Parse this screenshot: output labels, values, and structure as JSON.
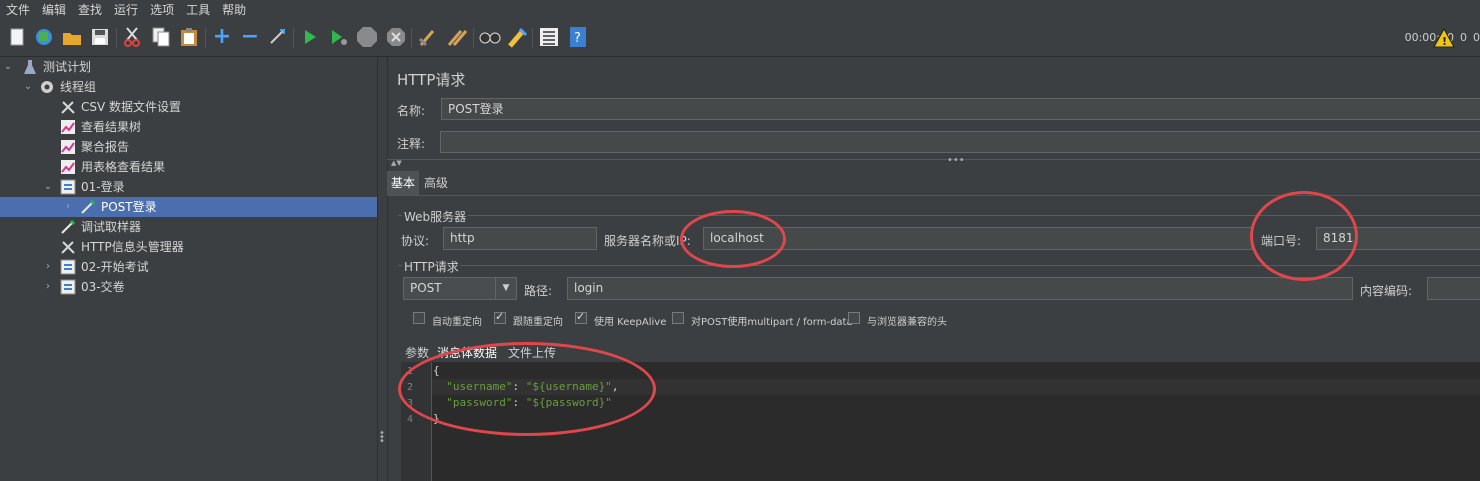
{
  "menu": [
    "文件",
    "编辑",
    "查找",
    "运行",
    "选项",
    "工具",
    "帮助"
  ],
  "toolbar": {
    "icons": [
      "new-icon",
      "templates-icon",
      "open-icon",
      "save-icon",
      "cut-icon",
      "copy-icon",
      "paste-icon",
      "expand-icon",
      "collapse-icon",
      "toggle-icon",
      "start-icon",
      "start-no-pause-icon",
      "stop-icon",
      "shutdown-icon",
      "clear-icon",
      "clear-all-icon",
      "search-icon",
      "reset-search-icon",
      "function-helper-icon",
      "help-icon"
    ],
    "timer": "00:00:00",
    "warn_count": "0",
    "thread_count": "0"
  },
  "tree": {
    "items": [
      {
        "label": "测试计划",
        "icon": "flask-icon"
      },
      {
        "label": "线程组",
        "icon": "gear-icon"
      },
      {
        "label": "CSV 数据文件设置",
        "icon": "wrench-icon"
      },
      {
        "label": "查看结果树",
        "icon": "chart-icon"
      },
      {
        "label": "聚合报告",
        "icon": "chart-icon"
      },
      {
        "label": "用表格查看结果",
        "icon": "chart-icon"
      },
      {
        "label": "01-登录",
        "icon": "controller-icon"
      },
      {
        "label": "POST登录",
        "icon": "sampler-icon"
      },
      {
        "label": "调试取样器",
        "icon": "sampler-icon"
      },
      {
        "label": "HTTP信息头管理器",
        "icon": "wrench-icon"
      },
      {
        "label": "02-开始考试",
        "icon": "controller-icon"
      },
      {
        "label": "03-交卷",
        "icon": "controller-icon"
      }
    ]
  },
  "panel": {
    "title": "HTTP请求",
    "name_label": "名称:",
    "name_value": "POST登录",
    "comment_label": "注释:",
    "comment_value": "",
    "tabs": [
      "基本",
      "高级"
    ],
    "web_server_legend": "Web服务器",
    "protocol_label": "协议:",
    "protocol_value": "http",
    "server_label": "服务器名称或IP:",
    "server_value": "localhost",
    "port_label": "端口号:",
    "port_value": "8181",
    "http_legend": "HTTP请求",
    "method_value": "POST",
    "path_label": "路径:",
    "path_value": "login",
    "encoding_label": "内容编码:",
    "checkboxes": [
      {
        "label": "自动重定向",
        "checked": false
      },
      {
        "label": "跟随重定向",
        "checked": true
      },
      {
        "label": "使用 KeepAlive",
        "checked": true
      },
      {
        "label": "对POST使用multipart / form-data",
        "checked": false
      },
      {
        "label": "与浏览器兼容的头",
        "checked": false
      }
    ],
    "subtabs": [
      "参数",
      "消息体数据",
      "文件上传"
    ],
    "body_lines": [
      {
        "num": "1",
        "text": "{"
      },
      {
        "num": "2",
        "key": "\"username\"",
        "sep": ": ",
        "val": "\"${username}\"",
        "tail": ","
      },
      {
        "num": "3",
        "key": "\"password\"",
        "sep": ": ",
        "val": "\"${password}\"",
        "tail": ""
      },
      {
        "num": "4",
        "text": "}"
      }
    ]
  },
  "colors": {
    "accent_selection": "#4b6eaf",
    "annotation": "#e0474c"
  }
}
